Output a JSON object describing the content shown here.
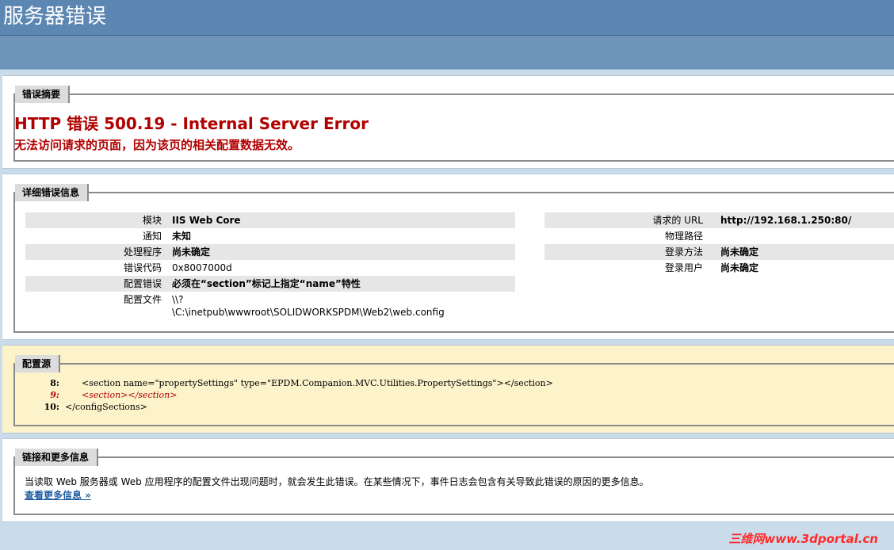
{
  "page": {
    "title": "服务器错误"
  },
  "summary": {
    "legend": "错误摘要",
    "error_title": "HTTP 错误 500.19 - Internal Server Error",
    "error_desc": "无法访问请求的页面，因为该页的相关配置数据无效。"
  },
  "details": {
    "legend": "详细错误信息",
    "left": [
      {
        "label": "模块",
        "value": "IIS Web Core"
      },
      {
        "label": "通知",
        "value": "未知"
      },
      {
        "label": "处理程序",
        "value": "尚未确定"
      },
      {
        "label": "错误代码",
        "value": "0x8007000d"
      },
      {
        "label": "配置错误",
        "value": "必须在“section”标记上指定“name”特性"
      },
      {
        "label": "配置文件",
        "value_line1": "\\\\?",
        "value_line2": "\\C:\\inetpub\\wwwroot\\SOLIDWORKSPDM\\Web2\\web.config"
      }
    ],
    "right": [
      {
        "label": "请求的 URL",
        "value": "http://192.168.1.250:80/"
      },
      {
        "label": "物理路径",
        "value": ""
      },
      {
        "label": "登录方法",
        "value": "尚未确定"
      },
      {
        "label": "登录用户",
        "value": "尚未确定"
      }
    ]
  },
  "config_source": {
    "legend": "配置源",
    "lines": [
      {
        "num": "8:",
        "text": "        <section name=\"propertySettings\" type=\"EPDM.Companion.MVC.Utilities.PropertySettings\"></section>"
      },
      {
        "num": "9:",
        "text": "        <section></section>"
      },
      {
        "num": "10:",
        "text": "  </configSections>"
      }
    ]
  },
  "more_info": {
    "legend": "链接和更多信息",
    "text": "当读取 Web 服务器或 Web 应用程序的配置文件出现问题时，就会发生此错误。在某些情况下，事件日志会包含有关导致此错误的原因的更多信息。",
    "link": "查看更多信息 »"
  },
  "watermark": "三维网www.3dportal.cn",
  "colors": {
    "header": "#5c87b2",
    "error_red": "#b00000",
    "link_blue": "#1c5b9e",
    "config_bg": "#fcf3cb"
  }
}
